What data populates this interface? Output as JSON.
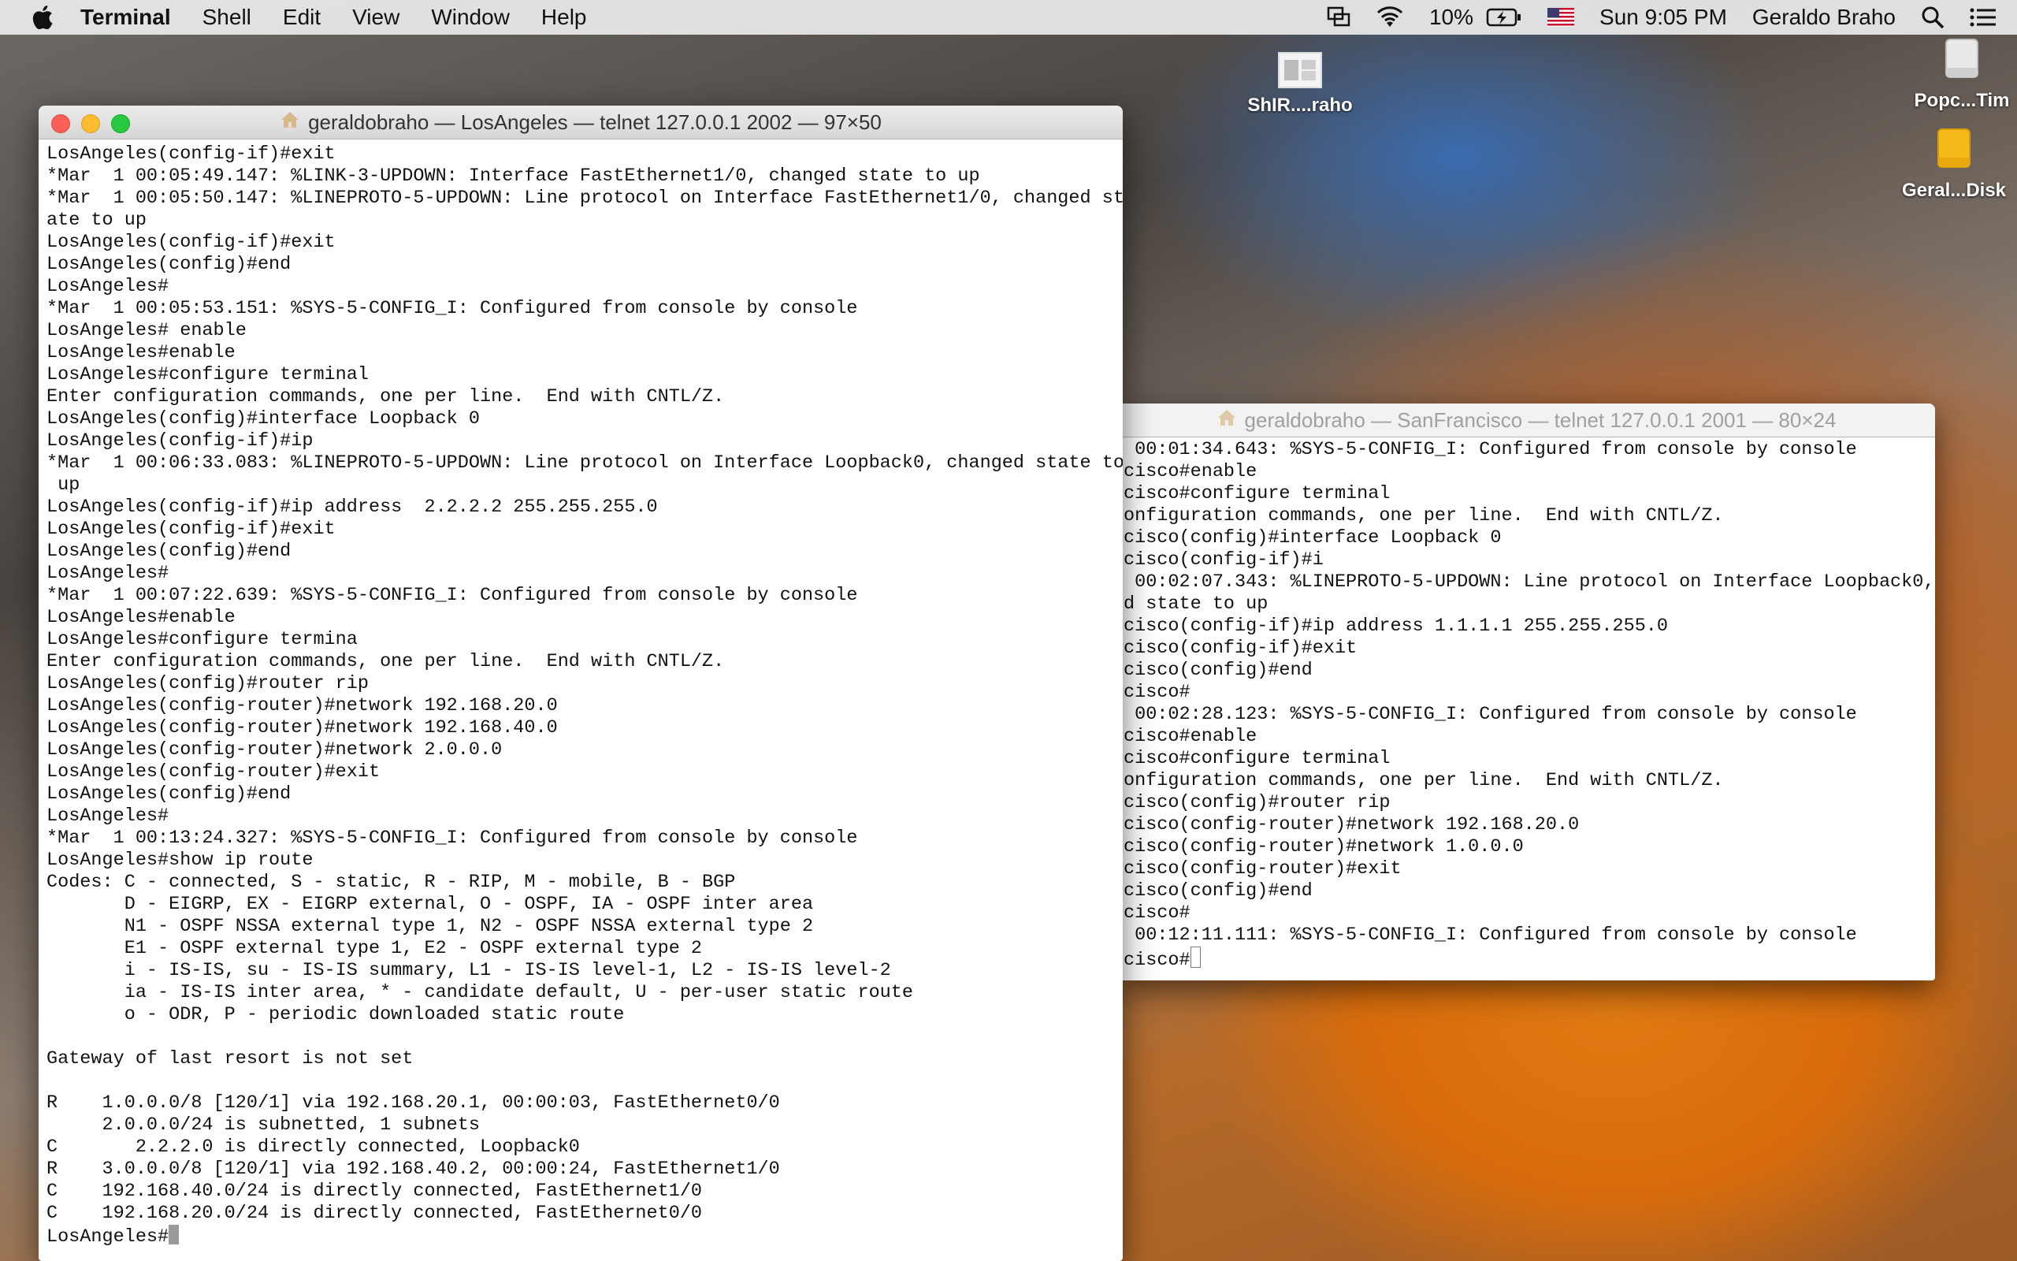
{
  "menubar": {
    "app_name": "Terminal",
    "items": [
      "Shell",
      "Edit",
      "View",
      "Window",
      "Help"
    ],
    "battery": "10%",
    "datetime": "Sun 9:05 PM",
    "user": "Geraldo Braho"
  },
  "desktop_icons": [
    {
      "label": "ShIR....raho",
      "icon": "screenshot-file-icon"
    },
    {
      "label": "Popc...Tim",
      "icon": "drive-icon"
    },
    {
      "label": "Geral...Disk",
      "icon": "external-disk-icon"
    }
  ],
  "window_la": {
    "title": "geraldobraho — LosAngeles — telnet 127.0.0.1 2002 — 97×50",
    "lines": [
      "LosAngeles(config-if)#exit",
      "*Mar  1 00:05:49.147: %LINK-3-UPDOWN: Interface FastEthernet1/0, changed state to up",
      "*Mar  1 00:05:50.147: %LINEPROTO-5-UPDOWN: Line protocol on Interface FastEthernet1/0, changed st",
      "ate to up",
      "LosAngeles(config-if)#exit",
      "LosAngeles(config)#end",
      "LosAngeles#",
      "*Mar  1 00:05:53.151: %SYS-5-CONFIG_I: Configured from console by console",
      "LosAngeles# enable",
      "LosAngeles#enable",
      "LosAngeles#configure terminal",
      "Enter configuration commands, one per line.  End with CNTL/Z.",
      "LosAngeles(config)#interface Loopback 0",
      "LosAngeles(config-if)#ip",
      "*Mar  1 00:06:33.083: %LINEPROTO-5-UPDOWN: Line protocol on Interface Loopback0, changed state to",
      " up",
      "LosAngeles(config-if)#ip address  2.2.2.2 255.255.255.0",
      "LosAngeles(config-if)#exit",
      "LosAngeles(config)#end",
      "LosAngeles#",
      "*Mar  1 00:07:22.639: %SYS-5-CONFIG_I: Configured from console by console",
      "LosAngeles#enable",
      "LosAngeles#configure termina",
      "Enter configuration commands, one per line.  End with CNTL/Z.",
      "LosAngeles(config)#router rip",
      "LosAngeles(config-router)#network 192.168.20.0",
      "LosAngeles(config-router)#network 192.168.40.0",
      "LosAngeles(config-router)#network 2.0.0.0",
      "LosAngeles(config-router)#exit",
      "LosAngeles(config)#end",
      "LosAngeles#",
      "*Mar  1 00:13:24.327: %SYS-5-CONFIG_I: Configured from console by console",
      "LosAngeles#show ip route",
      "Codes: C - connected, S - static, R - RIP, M - mobile, B - BGP",
      "       D - EIGRP, EX - EIGRP external, O - OSPF, IA - OSPF inter area",
      "       N1 - OSPF NSSA external type 1, N2 - OSPF NSSA external type 2",
      "       E1 - OSPF external type 1, E2 - OSPF external type 2",
      "       i - IS-IS, su - IS-IS summary, L1 - IS-IS level-1, L2 - IS-IS level-2",
      "       ia - IS-IS inter area, * - candidate default, U - per-user static route",
      "       o - ODR, P - periodic downloaded static route",
      "",
      "Gateway of last resort is not set",
      "",
      "R    1.0.0.0/8 [120/1] via 192.168.20.1, 00:00:03, FastEthernet0/0",
      "     2.0.0.0/24 is subnetted, 1 subnets",
      "C       2.2.2.0 is directly connected, Loopback0",
      "R    3.0.0.0/8 [120/1] via 192.168.40.2, 00:00:24, FastEthernet1/0",
      "C    192.168.40.0/24 is directly connected, FastEthernet1/0",
      "C    192.168.20.0/24 is directly connected, FastEthernet0/0"
    ],
    "prompt": "LosAngeles#"
  },
  "window_sf": {
    "title": "geraldobraho — SanFrancisco — telnet 127.0.0.1 2001 — 80×24",
    "lines": [
      " 00:01:34.643: %SYS-5-CONFIG_I: Configured from console by console",
      "cisco#enable",
      "cisco#configure terminal",
      "onfiguration commands, one per line.  End with CNTL/Z.",
      "cisco(config)#interface Loopback 0",
      "cisco(config-if)#i",
      " 00:02:07.343: %LINEPROTO-5-UPDOWN: Line protocol on Interface Loopback0,",
      "d state to up",
      "cisco(config-if)#ip address 1.1.1.1 255.255.255.0",
      "cisco(config-if)#exit",
      "cisco(config)#end",
      "cisco#",
      " 00:02:28.123: %SYS-5-CONFIG_I: Configured from console by console",
      "cisco#enable",
      "cisco#configure terminal",
      "onfiguration commands, one per line.  End with CNTL/Z.",
      "cisco(config)#router rip",
      "cisco(config-router)#network 192.168.20.0",
      "cisco(config-router)#network 1.0.0.0",
      "cisco(config-router)#exit",
      "cisco(config)#end",
      "cisco#",
      " 00:12:11.111: %SYS-5-CONFIG_I: Configured from console by console"
    ],
    "prompt": "cisco#"
  }
}
